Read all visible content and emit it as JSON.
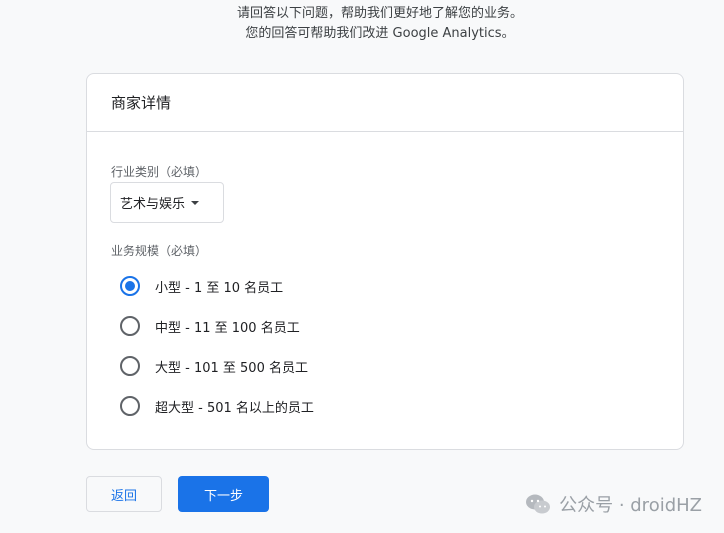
{
  "intro": {
    "line1": "请回答以下问题，帮助我们更好地了解您的业务。",
    "line2": "您的回答可帮助我们改进 Google Analytics。"
  },
  "card": {
    "title": "商家详情",
    "industry_label": "行业类别（必填）",
    "industry_value": "艺术与娱乐",
    "size_label": "业务规模（必填）",
    "size_options": [
      {
        "label": "小型 - 1 至 10 名员工",
        "checked": true
      },
      {
        "label": "中型 - 11 至 100 名员工",
        "checked": false
      },
      {
        "label": "大型 - 101 至 500 名员工",
        "checked": false
      },
      {
        "label": "超大型 - 501 名以上的员工",
        "checked": false
      }
    ]
  },
  "buttons": {
    "back": "返回",
    "next": "下一步"
  },
  "watermark": {
    "text": "公众号 · droidHZ"
  },
  "colors": {
    "accent": "#1a73e8",
    "background": "#f8f9fa",
    "border": "#dadce0"
  }
}
